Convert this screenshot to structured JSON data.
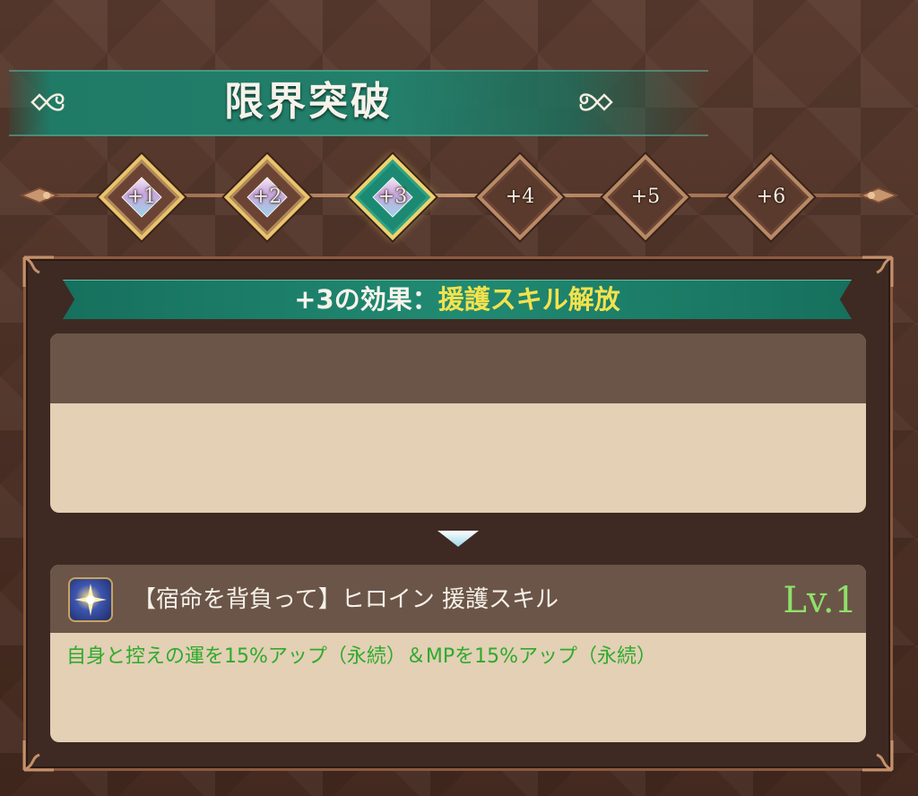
{
  "header": {
    "title": "限界突破"
  },
  "limit_break": {
    "steps": [
      {
        "label": "+1",
        "state": "done"
      },
      {
        "label": "+2",
        "state": "done"
      },
      {
        "label": "+3",
        "state": "current"
      },
      {
        "label": "+4",
        "state": "locked"
      },
      {
        "label": "+5",
        "state": "locked"
      },
      {
        "label": "+6",
        "state": "locked"
      }
    ]
  },
  "effect": {
    "prefix": "+3の効果：",
    "value": "援護スキル解放"
  },
  "skill": {
    "icon": "star-burst-icon",
    "name": "【宿命を背負って】ヒロイン 援護スキル",
    "level": "Lv.1",
    "description": "自身と控えの運を15%アップ（永続）＆MPを15%アップ（永続）"
  },
  "colors": {
    "background": "#4a3026",
    "banner_teal": "#23806b",
    "effect_highlight": "#f4e24c",
    "level_green": "#8fe06a",
    "description_green": "#2faa2c",
    "card_body": "#e3d0b5",
    "card_head": "#6b5548"
  }
}
